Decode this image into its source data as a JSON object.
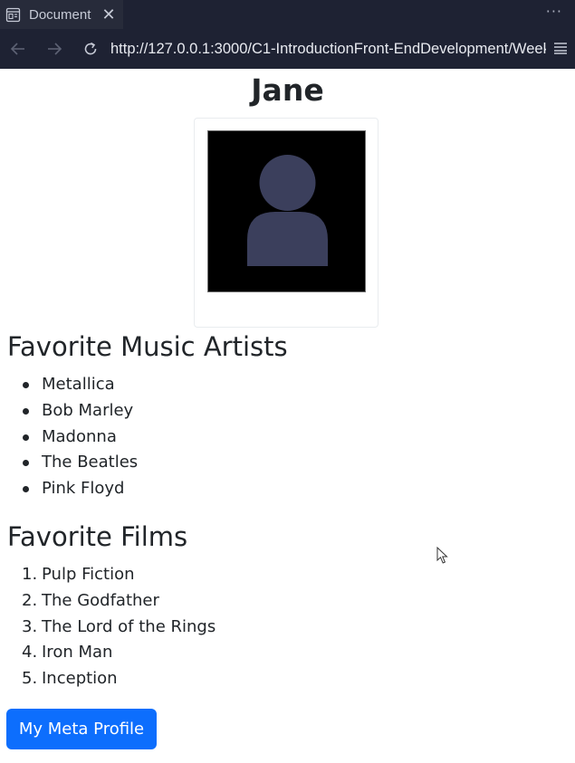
{
  "browser": {
    "tab_title": "Document",
    "tab_close_glyph": "✕",
    "more_glyph": "···",
    "url": "http://127.0.0.1:3000/C1-IntroductionFront-EndDevelopment/Week",
    "icons": {
      "tab": "page-icon",
      "back": "arrow-left-icon",
      "forward": "arrow-right-icon",
      "refresh": "refresh-icon",
      "menu": "hamburger-menu-icon"
    }
  },
  "profile": {
    "name": "Jane",
    "photo_icon": "person-avatar-icon"
  },
  "music": {
    "title": "Favorite Music Artists",
    "items": [
      "Metallica",
      "Bob Marley",
      "Madonna",
      "The Beatles",
      "Pink Floyd"
    ]
  },
  "films": {
    "title": "Favorite Films",
    "items": [
      {
        "num": "1.",
        "label": "Pulp Fiction"
      },
      {
        "num": "2.",
        "label": "The Godfather"
      },
      {
        "num": "3.",
        "label": "The Lord of the Rings"
      },
      {
        "num": "4.",
        "label": "Iron Man"
      },
      {
        "num": "5.",
        "label": "Inception"
      }
    ]
  },
  "button": {
    "label": "My Meta Profile"
  },
  "colors": {
    "chrome_bg": "#1e2233",
    "tab_bg": "#272b3a",
    "primary_button": "#0d6efd",
    "text": "#212529",
    "avatar": "#3b3f5c"
  }
}
